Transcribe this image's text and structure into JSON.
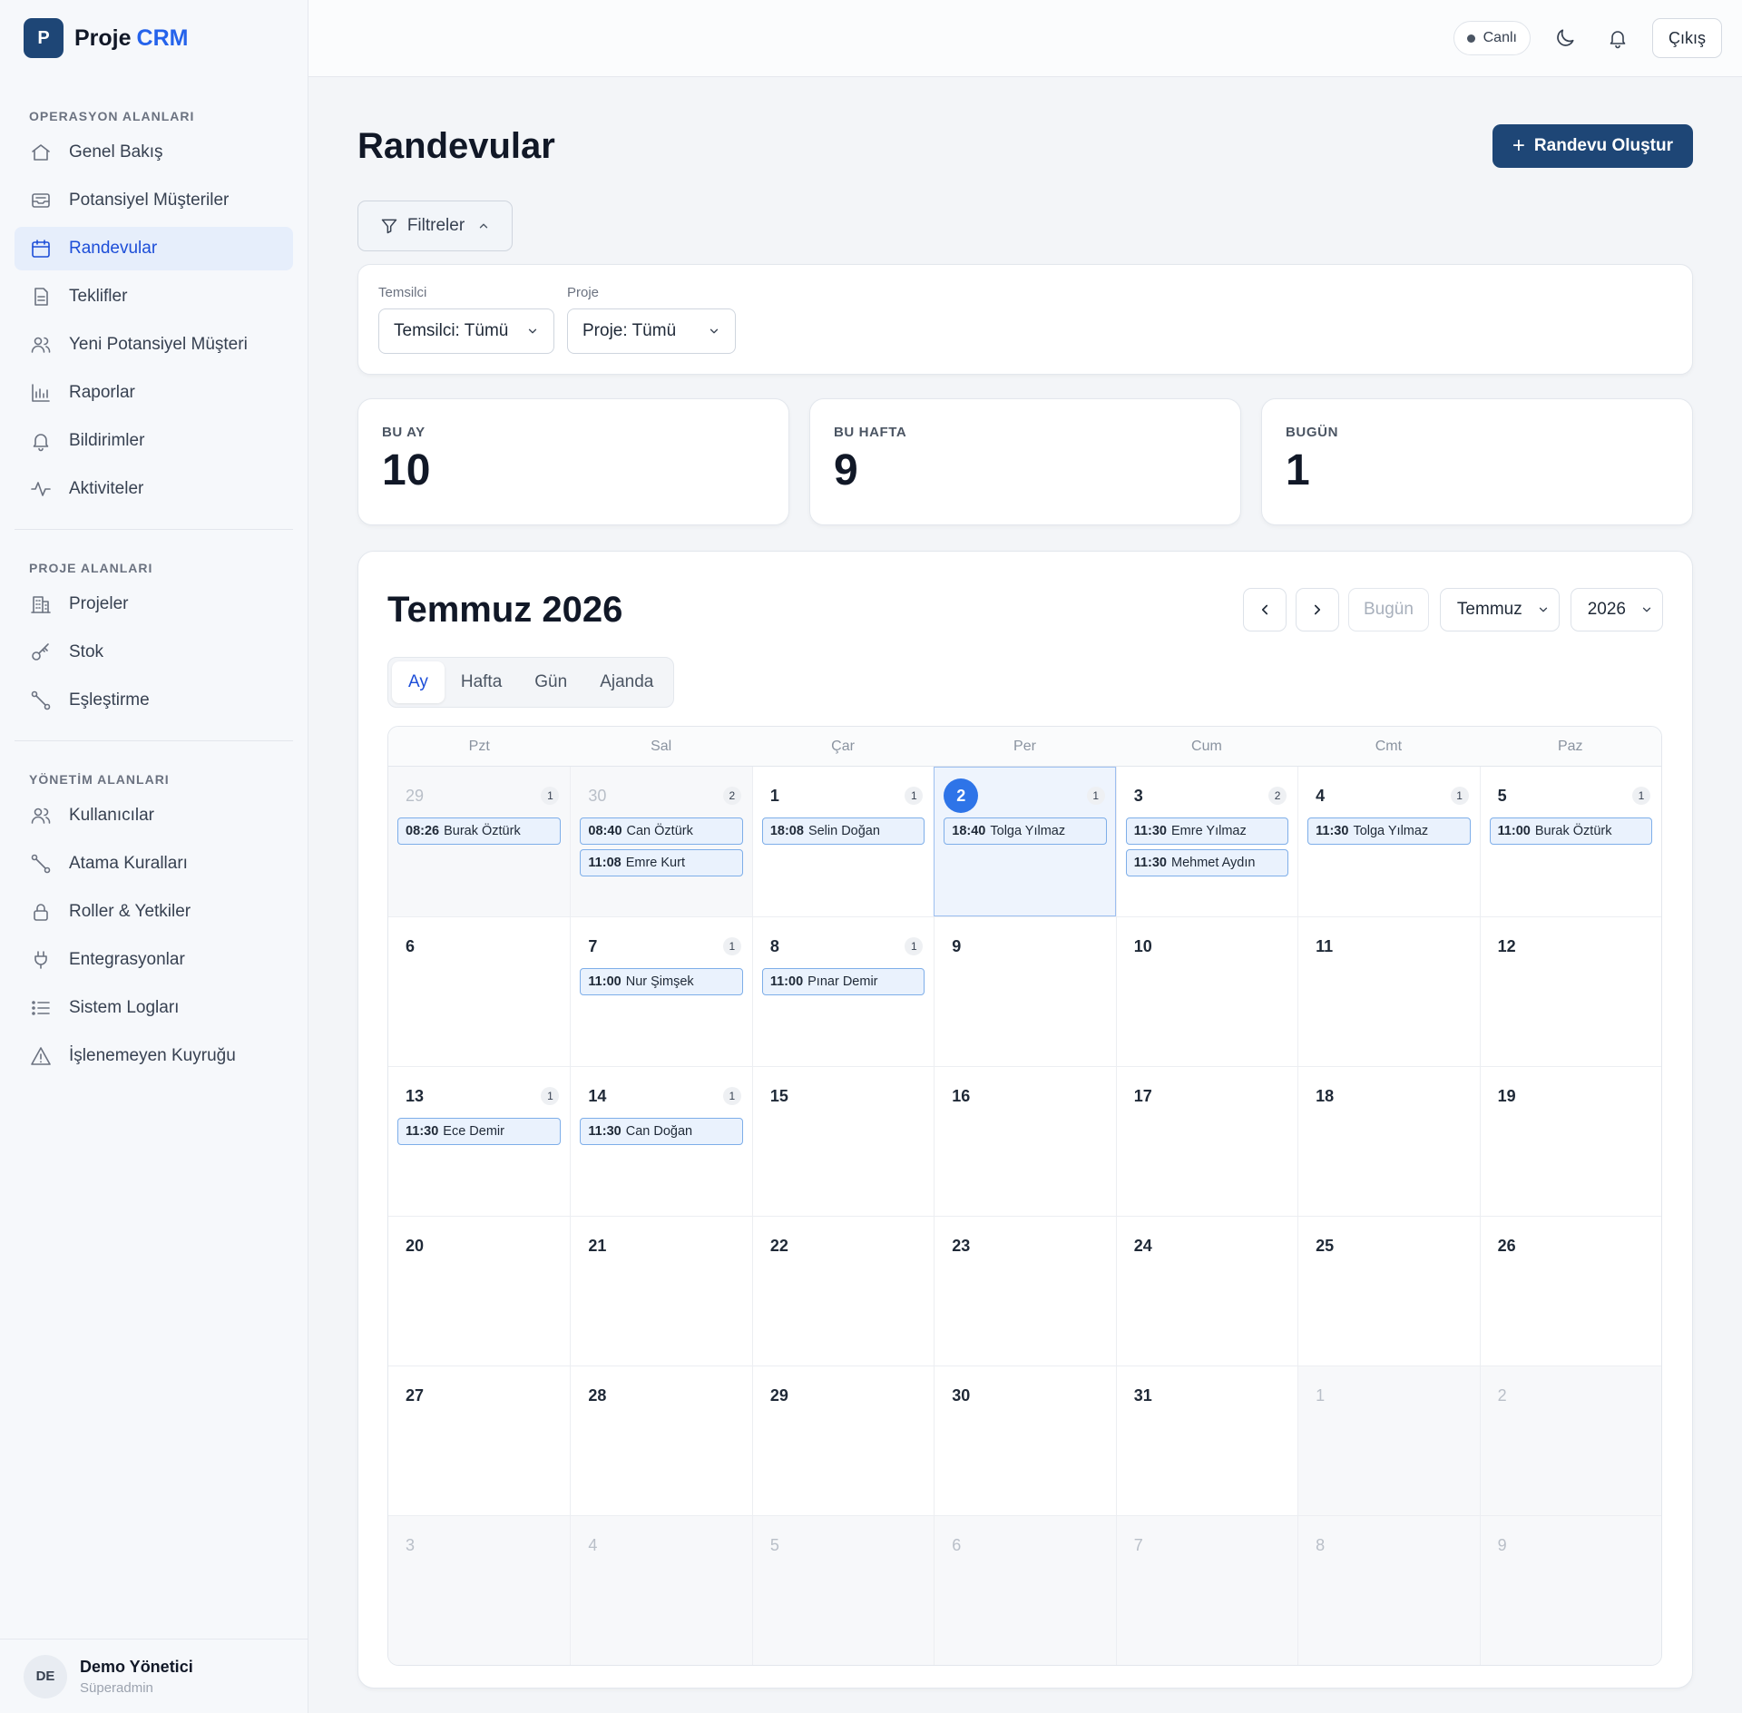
{
  "brand": {
    "logo_letter": "P",
    "name": "Proje",
    "accent": "CRM"
  },
  "sidebar": {
    "sections": [
      {
        "label": "OPERASYON ALANLARI",
        "items": [
          {
            "label": "Genel Bakış",
            "icon": "home-icon"
          },
          {
            "label": "Potansiyel Müşteriler",
            "icon": "inbox-icon"
          },
          {
            "label": "Randevular",
            "icon": "calendar-icon",
            "active": true
          },
          {
            "label": "Teklifler",
            "icon": "document-icon"
          },
          {
            "label": "Yeni Potansiyel Müşteri",
            "icon": "users-icon"
          },
          {
            "label": "Raporlar",
            "icon": "bar-chart-icon"
          },
          {
            "label": "Bildirimler",
            "icon": "bell-icon"
          },
          {
            "label": "Aktiviteler",
            "icon": "activity-icon"
          }
        ]
      },
      {
        "label": "PROJE ALANLARI",
        "items": [
          {
            "label": "Projeler",
            "icon": "building-icon"
          },
          {
            "label": "Stok",
            "icon": "key-icon"
          },
          {
            "label": "Eşleştirme",
            "icon": "route-icon"
          }
        ]
      },
      {
        "label": "YÖNETİM ALANLARI",
        "items": [
          {
            "label": "Kullanıcılar",
            "icon": "users-icon"
          },
          {
            "label": "Atama Kuralları",
            "icon": "route-icon"
          },
          {
            "label": "Roller & Yetkiler",
            "icon": "lock-icon"
          },
          {
            "label": "Entegrasyonlar",
            "icon": "plug-icon"
          },
          {
            "label": "Sistem Logları",
            "icon": "list-icon"
          },
          {
            "label": "İşlenemeyen Kuyruğu",
            "icon": "warning-icon"
          }
        ]
      }
    ],
    "user": {
      "initials": "DE",
      "name": "Demo Yönetici",
      "role": "Süperadmin"
    }
  },
  "topbar": {
    "live_label": "Canlı",
    "logout_label": "Çıkış"
  },
  "page": {
    "title": "Randevular",
    "create_label": "Randevu Oluştur"
  },
  "filters": {
    "toggle_label": "Filtreler",
    "fields": [
      {
        "label": "Temsilci",
        "value": "Temsilci: Tümü",
        "width": 194
      },
      {
        "label": "Proje",
        "value": "Proje: Tümü",
        "width": 186
      }
    ]
  },
  "stats": [
    {
      "label": "BU AY",
      "value": "10"
    },
    {
      "label": "BU HAFTA",
      "value": "9"
    },
    {
      "label": "BUGÜN",
      "value": "1"
    }
  ],
  "calendar": {
    "title": "Temmuz 2026",
    "today_label": "Bugün",
    "month_select": "Temmuz",
    "year_select": "2026",
    "views": [
      "Ay",
      "Hafta",
      "Gün",
      "Ajanda"
    ],
    "active_view": "Ay",
    "weekdays": [
      "Pzt",
      "Sal",
      "Çar",
      "Per",
      "Cum",
      "Cmt",
      "Paz"
    ],
    "weeks": [
      [
        {
          "day": "29",
          "muted": true,
          "count": "1",
          "events": [
            {
              "time": "08:26",
              "name": "Burak Öztürk"
            }
          ]
        },
        {
          "day": "30",
          "muted": true,
          "count": "2",
          "events": [
            {
              "time": "08:40",
              "name": "Can Öztürk"
            },
            {
              "time": "11:08",
              "name": "Emre Kurt"
            }
          ]
        },
        {
          "day": "1",
          "count": "1",
          "events": [
            {
              "time": "18:08",
              "name": "Selin Doğan"
            }
          ]
        },
        {
          "day": "2",
          "today": true,
          "count": "1",
          "events": [
            {
              "time": "18:40",
              "name": "Tolga Yılmaz"
            }
          ]
        },
        {
          "day": "3",
          "count": "2",
          "events": [
            {
              "time": "11:30",
              "name": "Emre Yılmaz"
            },
            {
              "time": "11:30",
              "name": "Mehmet Aydın"
            }
          ]
        },
        {
          "day": "4",
          "count": "1",
          "events": [
            {
              "time": "11:30",
              "name": "Tolga Yılmaz"
            }
          ]
        },
        {
          "day": "5",
          "count": "1",
          "events": [
            {
              "time": "11:00",
              "name": "Burak Öztürk"
            }
          ]
        }
      ],
      [
        {
          "day": "6"
        },
        {
          "day": "7",
          "count": "1",
          "events": [
            {
              "time": "11:00",
              "name": "Nur Şimşek"
            }
          ]
        },
        {
          "day": "8",
          "count": "1",
          "events": [
            {
              "time": "11:00",
              "name": "Pınar Demir"
            }
          ]
        },
        {
          "day": "9"
        },
        {
          "day": "10"
        },
        {
          "day": "11"
        },
        {
          "day": "12"
        }
      ],
      [
        {
          "day": "13",
          "count": "1",
          "events": [
            {
              "time": "11:30",
              "name": "Ece Demir"
            }
          ]
        },
        {
          "day": "14",
          "count": "1",
          "events": [
            {
              "time": "11:30",
              "name": "Can Doğan"
            }
          ]
        },
        {
          "day": "15"
        },
        {
          "day": "16"
        },
        {
          "day": "17"
        },
        {
          "day": "18"
        },
        {
          "day": "19"
        }
      ],
      [
        {
          "day": "20"
        },
        {
          "day": "21"
        },
        {
          "day": "22"
        },
        {
          "day": "23"
        },
        {
          "day": "24"
        },
        {
          "day": "25"
        },
        {
          "day": "26"
        }
      ],
      [
        {
          "day": "27"
        },
        {
          "day": "28"
        },
        {
          "day": "29"
        },
        {
          "day": "30"
        },
        {
          "day": "31"
        },
        {
          "day": "1",
          "muted": true
        },
        {
          "day": "2",
          "muted": true
        }
      ],
      [
        {
          "day": "3",
          "muted": true
        },
        {
          "day": "4",
          "muted": true
        },
        {
          "day": "5",
          "muted": true
        },
        {
          "day": "6",
          "muted": true
        },
        {
          "day": "7",
          "muted": true
        },
        {
          "day": "8",
          "muted": true
        },
        {
          "day": "9",
          "muted": true
        }
      ]
    ]
  },
  "colors": {
    "brand": "#1e4676",
    "accent": "#2563eb",
    "today": "#2e74e8"
  }
}
